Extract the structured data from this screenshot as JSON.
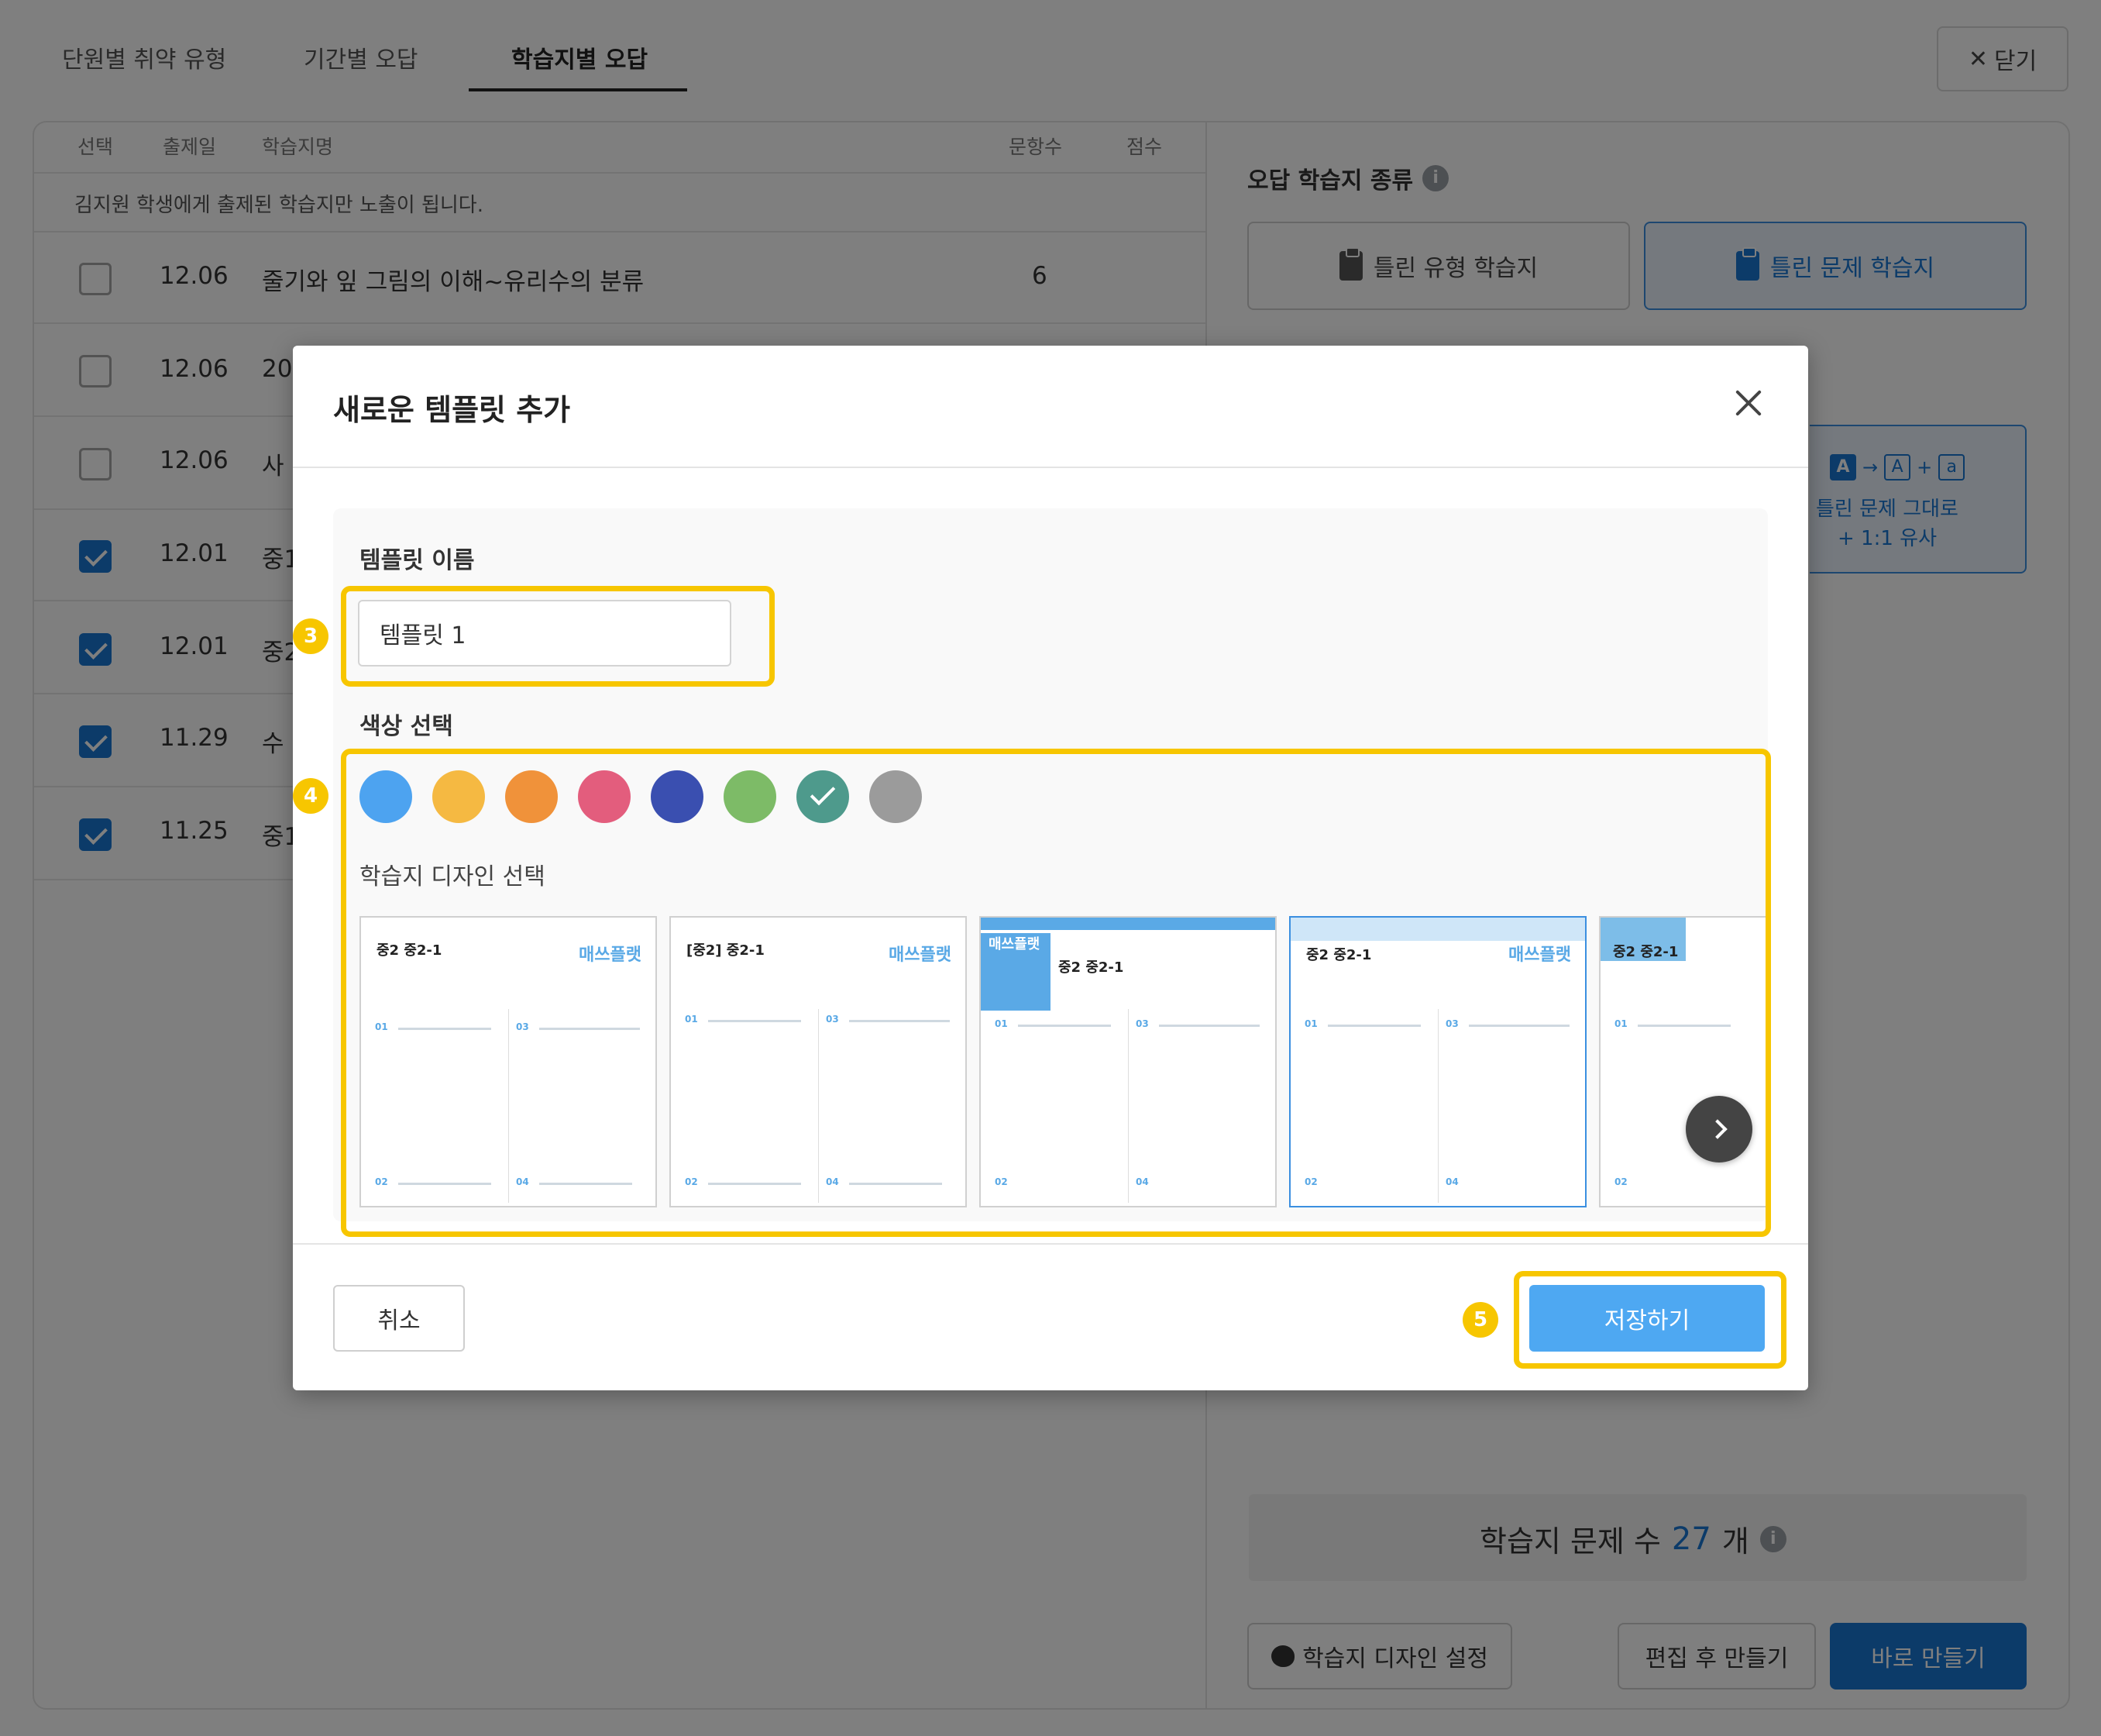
{
  "tabs": [
    "단원별 취약 유형",
    "기간별 오답",
    "학습지별 오답"
  ],
  "close_label": "닫기",
  "table": {
    "headers": {
      "select": "선택",
      "date": "출제일",
      "name": "학습지명",
      "count": "문항수",
      "score": "점수"
    },
    "notice": "김지원 학생에게 출제된 학습지만 노출이 됩니다.",
    "rows": [
      {
        "date": "12.06",
        "name": "줄기와 잎 그림의 이해~유리수의 분류",
        "count": "6",
        "checked": false
      },
      {
        "date": "12.06",
        "name": "20",
        "count": "",
        "checked": false
      },
      {
        "date": "12.06",
        "name": "사",
        "count": "",
        "checked": false
      },
      {
        "date": "12.01",
        "name": "중1",
        "count": "",
        "checked": true
      },
      {
        "date": "12.01",
        "name": "중2",
        "count": "",
        "checked": true
      },
      {
        "date": "11.29",
        "name": "수",
        "count": "",
        "checked": true
      },
      {
        "date": "11.25",
        "name": "중1",
        "count": "",
        "checked": true
      }
    ]
  },
  "right_panel": {
    "title": "오답 학습지 종류",
    "type_wrong_kind": "틀린 유형 학습지",
    "type_wrong_problem": "틀린 문제 학습지",
    "similar": {
      "box1": "A",
      "box2": "A",
      "box3": "a",
      "label_line1": "틀린 문제 그대로",
      "label_line2": "+ 1:1 유사"
    },
    "count_label": "학습지 문제 수",
    "count_value": "27",
    "count_unit": "개",
    "btn_design": "학습지 디자인 설정",
    "btn_edit": "편집 후 만들기",
    "btn_make": "바로 만들기"
  },
  "modal": {
    "title": "새로운 템플릿 추가",
    "name_label": "템플릿 이름",
    "name_value": "템플릿 1",
    "color_label": "색상 선택",
    "colors": [
      "#4da3f0",
      "#f5b942",
      "#f0923a",
      "#e35d7d",
      "#3a4fb0",
      "#7dbb67",
      "#4e9a8c",
      "#9b9b9b"
    ],
    "selected_color_index": 6,
    "design_label": "학습지 디자인 선택",
    "designs": [
      {
        "title": "중2 중2-1",
        "logo": "매쓰플랫"
      },
      {
        "title": "[중2] 중2-1",
        "logo": "매쓰플랫"
      },
      {
        "title": "중2 중2-1",
        "logo": "매쓰플랫"
      },
      {
        "title": "중2 중2-1",
        "logo": "매쓰플랫"
      },
      {
        "title": "중2 중2-1",
        "logo": ""
      }
    ],
    "cancel": "취소",
    "save": "저장하기"
  },
  "badges": [
    "3",
    "4",
    "5"
  ]
}
